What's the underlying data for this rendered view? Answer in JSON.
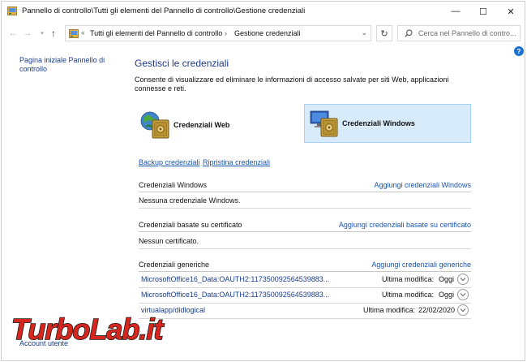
{
  "window": {
    "title": "Pannello di controllo\\Tutti gli elementi del Pannello di controllo\\Gestione credenziali",
    "min_glyph": "—",
    "max_glyph": "☐",
    "close_glyph": "✕"
  },
  "nav": {
    "back_glyph": "←",
    "forward_glyph": "→",
    "recent_glyph": "▾",
    "up_glyph": "↑"
  },
  "address": {
    "chevron": "«",
    "path_parent": "Tutti gli elementi del Pannello di controllo",
    "separator": "›",
    "path_current": "Gestione credenziali",
    "dropdown_glyph": "⌄",
    "refresh_glyph": "↻"
  },
  "search": {
    "placeholder": "Cerca nel Pannello di contro..."
  },
  "help": {
    "glyph": "?"
  },
  "sidebar": {
    "home_link": "Pagina iniziale Pannello di controllo",
    "bottom_link": "Account utente"
  },
  "main": {
    "title": "Gestisci le credenziali",
    "description": "Consente di visualizzare ed eliminare le informazioni di accesso salvate per siti Web, applicazioni connesse e reti.",
    "tiles": {
      "web_label": "Credenziali Web",
      "windows_label": "Credenziali Windows"
    },
    "backup_link": "Backup credenziali",
    "restore_link": "Ripristina credenziali",
    "sections": {
      "windows": {
        "title": "Credenziali Windows",
        "add_link": "Aggiungi credenziali Windows",
        "empty_text": "Nessuna credenziale Windows."
      },
      "certificate": {
        "title": "Credenziali basate su certificato",
        "add_link": "Aggiungi credenziali basate su certificato",
        "empty_text": "Nessun certificato."
      },
      "generic": {
        "title": "Credenziali generiche",
        "add_link": "Aggiungi credenziali generiche",
        "items": [
          {
            "name": "MicrosoftOffice16_Data:OAUTH2:117350092564539883...",
            "modified_label": "Ultima modifica:",
            "modified_value": "Oggi"
          },
          {
            "name": "MicrosoftOffice16_Data:OAUTH2:117350092564539883...",
            "modified_label": "Ultima modifica:",
            "modified_value": "Oggi"
          },
          {
            "name": "virtualapp/didlogical",
            "modified_label": "Ultima modifica:",
            "modified_value": "22/02/2020"
          }
        ]
      }
    }
  },
  "watermark": {
    "text": "TurboLab.it"
  },
  "colors": {
    "link": "#1a55b0",
    "title_blue": "#1e3a8a",
    "selected_tile": "#d8ebfa",
    "watermark_red": "#d7261e",
    "watermark_dark": "#1b1b1b"
  }
}
